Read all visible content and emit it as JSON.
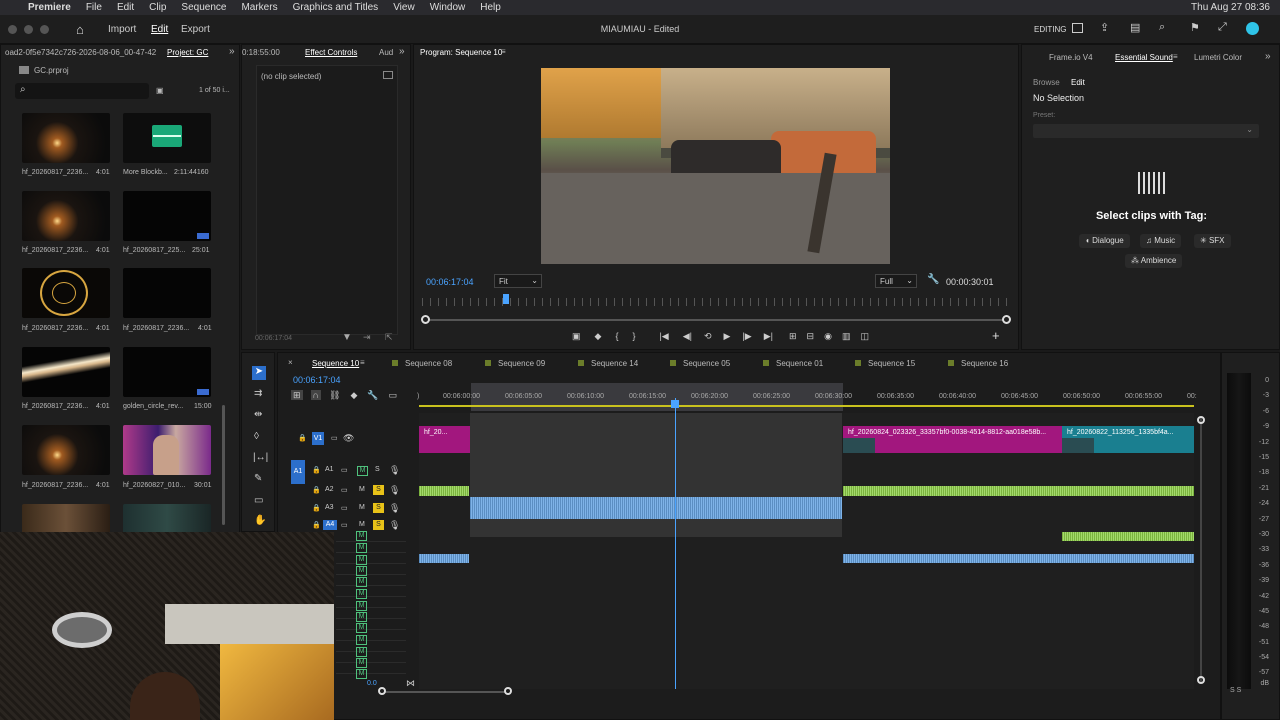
{
  "menubar": {
    "app": "Premiere",
    "items": [
      "File",
      "Edit",
      "Clip",
      "Sequence",
      "Markers",
      "Graphics and Titles",
      "View",
      "Window",
      "Help"
    ],
    "clock": "Thu Aug 27  08:36"
  },
  "appbar": {
    "tabs": [
      "Import",
      "Edit",
      "Export"
    ],
    "title": "MIAUMIAU - Edited",
    "workspace": "EDITING"
  },
  "project": {
    "header_path": "oad2-0f5e7342c726-2026-08-06_00-47-42",
    "header_tab": "Project: GC",
    "file": "GC.prproj",
    "count": "1 of 50 i...",
    "search_placeholder": "",
    "items": [
      {
        "name": "hf_20260817_2236...",
        "dur": "4:01"
      },
      {
        "name": "More Blockb...",
        "dur": "2:11:44160"
      },
      {
        "name": "hf_20260817_2236...",
        "dur": "4:01"
      },
      {
        "name": "hf_20260817_225...",
        "dur": "25:01"
      },
      {
        "name": "hf_20260817_2236...",
        "dur": "4:01"
      },
      {
        "name": "hf_20260817_2236...",
        "dur": "4:01"
      },
      {
        "name": "hf_20260817_2236...",
        "dur": "4:01"
      },
      {
        "name": "golden_circle_rev...",
        "dur": "15:00"
      },
      {
        "name": "hf_20260817_2236...",
        "dur": "4:01"
      },
      {
        "name": "hf_20260827_010...",
        "dur": "30:01"
      }
    ]
  },
  "effect_controls": {
    "time_left": "0:18:55:00",
    "tab": "Effect Controls",
    "tab2": "Aud",
    "no_clip": "(no clip selected)",
    "timecode": "00:06:17:04"
  },
  "program": {
    "tab": "Program: Sequence 10",
    "timecode": "00:06:17:04",
    "fit": "Fit",
    "quality": "Full",
    "duration": "00:00:30:01"
  },
  "essential": {
    "tabs": [
      "Frame.io V4",
      "Essential Sound",
      "Lumetri Color"
    ],
    "subtabs": [
      "Browse",
      "Edit"
    ],
    "no_selection": "No Selection",
    "preset_label": "Preset:",
    "heading": "Select clips with Tag:",
    "tags": [
      "Dialogue",
      "Music",
      "SFX",
      "Ambience"
    ]
  },
  "timeline": {
    "timecode": "00:06:17:04",
    "tabs": [
      "Sequence 10",
      "Sequence 08",
      "Sequence 09",
      "Sequence 14",
      "Sequence 05",
      "Sequence 01",
      "Sequence 15",
      "Sequence 16"
    ],
    "ruler": [
      "00:06:00:00",
      "00:06:05:00",
      "00:06:10:00",
      "00:06:15:00",
      "00:06:20:00",
      "00:06:25:00",
      "00:06:30:00",
      "00:06:35:00",
      "00:06:40:00",
      "00:06:45:00",
      "00:06:50:00",
      "00:06:55:00",
      "00:"
    ],
    "clips": {
      "v1a": "hf_20...",
      "v1b": "hf_20260824_023326_33357bf0-0038-4514-8812-aa018e58b...",
      "v1c": "hf_20260822_113256_1335bf4a..."
    },
    "tracks": [
      "V1",
      "A1",
      "A2",
      "A3",
      "A4"
    ],
    "zoom": "0.0"
  },
  "meter": {
    "labels": [
      "0",
      "-3",
      "-6",
      "-9",
      "-12",
      "-15",
      "-18",
      "-21",
      "-24",
      "-27",
      "-30",
      "-33",
      "-36",
      "-39",
      "-42",
      "-45",
      "-48",
      "-51",
      "-54",
      "-57",
      "dB"
    ],
    "solo": "S  S"
  }
}
